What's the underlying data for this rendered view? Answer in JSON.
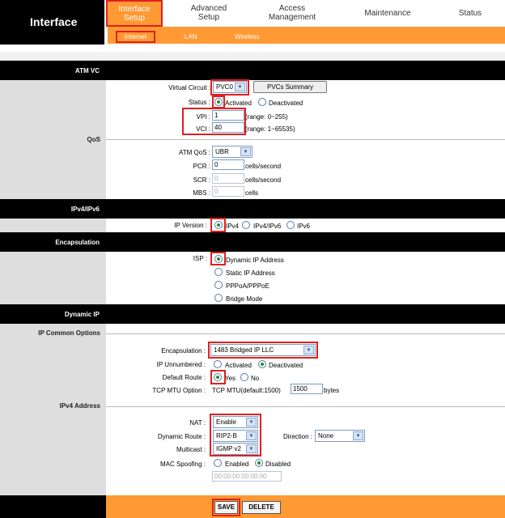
{
  "brand": "Interface",
  "nav": {
    "active": "Interface Setup",
    "advanced": "Advanced Setup",
    "access": "Access Management",
    "maintenance": "Maintenance",
    "status": "Status"
  },
  "subnav": {
    "internet": "Internet",
    "lan": "LAN",
    "wireless": "Wireless"
  },
  "sections": {
    "atm_vc": "ATM VC",
    "qos": "QoS",
    "ip_version": "IPv4/IPv6",
    "encapsulation": "Encapsulation",
    "dynamic_ip": "Dynamic IP",
    "ip_common": "IP Common Options",
    "ipv4_address": "IPv4 Address"
  },
  "atm": {
    "vc_label": "Virtual Circuit :",
    "vc_value": "PVC0",
    "pvcs_button": "PVCs Summary",
    "status_label": "Status :",
    "activated": "Activated",
    "deactivated": "Deactivated",
    "vpi_label": "VPI :",
    "vpi_value": "1",
    "vpi_range": "(range: 0~255)",
    "vci_label": "VCI :",
    "vci_value": "40",
    "vci_range": "(range: 1~65535)"
  },
  "qos": {
    "atm_qos_label": "ATM QoS :",
    "atm_qos_value": "UBR",
    "pcr_label": "PCR :",
    "pcr_value": "0",
    "scr_label": "SCR :",
    "scr_value": "0",
    "mbs_label": "MBS :",
    "mbs_value": "0",
    "unit": "cells/second",
    "mbs_unit": "cells"
  },
  "ipver": {
    "label": "IP Version :",
    "ipv4": "IPv4",
    "ipv4v6": "IPv4/IPv6",
    "ipv6": "IPv6"
  },
  "isp": {
    "label": "ISP :",
    "dynamic": "Dynamic IP Address",
    "static": "Static IP Address",
    "pppoa": "PPPoA/PPPoE",
    "bridge": "Bridge Mode"
  },
  "common": {
    "encap_label": "Encapsulation :",
    "encap_value": "1483 Bridged IP LLC",
    "unnumbered_label": "IP Unnumbered :",
    "activated": "Activated",
    "deactivated": "Deactivated",
    "default_route_label": "Default Route :",
    "yes": "Yes",
    "no": "No",
    "mtu_label": "TCP MTU Option :",
    "mtu_text": "TCP MTU(default:1500)",
    "mtu_value": "1500",
    "mtu_unit": "bytes"
  },
  "ipv4": {
    "nat_label": "NAT :",
    "nat_value": "Enable",
    "dynroute_label": "Dynamic Route :",
    "dynroute_value": "RIP2-B",
    "direction_label": "Direction :",
    "direction_value": "None",
    "multicast_label": "Multicast :",
    "multicast_value": "IGMP v2",
    "mac_label": "MAC Spoofing :",
    "enabled": "Enabled",
    "disabled": "Disabled",
    "mac_value": "00:00:00:00:00:00"
  },
  "footer": {
    "save": "SAVE",
    "delete": "DELETE"
  },
  "colors": {
    "accent": "#ff9933",
    "highlight": "#e02020",
    "bar": "#000000"
  }
}
